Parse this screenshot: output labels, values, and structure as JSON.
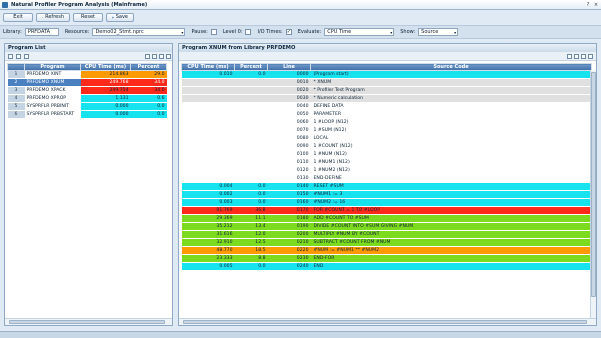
{
  "window": {
    "title": "Natural Profiler Program Analysis (Mainframe)",
    "help": "?",
    "close": "×"
  },
  "toolbar": {
    "exit": "Exit",
    "refresh": "Refresh",
    "reset": "Reset",
    "save": "Save"
  },
  "filters": {
    "library_label": "Library:",
    "library_value": "PRFDATA",
    "resource_label": "Resource:",
    "resource_value": "Demo02_Stmt.nprc",
    "pause_label": "Pause:",
    "pause_checked": false,
    "level0_label": "Level 0:",
    "level0_checked": false,
    "io_label": "I/O Times:",
    "io_checked": true,
    "checkmark": "✓",
    "evaluate_label": "Evaluate:",
    "evaluate_value": "CPU Time",
    "show_label": "Show:",
    "show_value": "Source",
    "dropdown_glyph": "▾"
  },
  "program_list": {
    "title": "Program List",
    "columns": {
      "program": "Program",
      "cpu": "CPU Time (ms)",
      "percent": "Percent"
    },
    "rows": [
      {
        "idx": "1",
        "program": "PRFDEMO XINT",
        "cpu": "214.863",
        "percent": "29.0",
        "cpu_color": "#ff9a00",
        "pct_color": "#ff9a00",
        "selected": false
      },
      {
        "idx": "2",
        "program": "PRFDEMO XNUM",
        "cpu": "249.768",
        "percent": "34.0",
        "cpu_color": "#ff2a1a",
        "pct_color": "#ff2a1a",
        "selected": true
      },
      {
        "idx": "3",
        "program": "PRFDEMO XPACK",
        "cpu": "249.754",
        "percent": "34.0",
        "cpu_color": "#ff2a1a",
        "pct_color": "#ff2a1a",
        "selected": false
      },
      {
        "idx": "4",
        "program": "PRFDEMO XPROP",
        "cpu": "1.131",
        "percent": "0.6",
        "cpu_color": "#17e3ef",
        "pct_color": "#17e3ef",
        "selected": false
      },
      {
        "idx": "5",
        "program": "SYSPRFLR PRBINIT",
        "cpu": "0.000",
        "percent": "0.0",
        "cpu_color": "#17e3ef",
        "pct_color": "#17e3ef",
        "selected": false
      },
      {
        "idx": "6",
        "program": "SYSPRFLR PRBSTART",
        "cpu": "0.000",
        "percent": "0.0",
        "cpu_color": "#17e3ef",
        "pct_color": "#17e3ef",
        "selected": false
      }
    ]
  },
  "source_panel": {
    "title": "Program XNUM from Library PRFDEMO",
    "columns": {
      "cpu": "CPU Time (ms)",
      "percent": "Percent",
      "line": "Line",
      "source": "Source Code"
    },
    "rows": [
      {
        "cpu": "0.010",
        "percent": "0.0",
        "line": "0000",
        "source": "(Program start)",
        "color": "#17e3ef"
      },
      {
        "cpu": "",
        "percent": "",
        "line": "0010",
        "source": "* XNUM",
        "color": "#e0e0e0"
      },
      {
        "cpu": "",
        "percent": "",
        "line": "0020",
        "source": "* Profiler Test Program",
        "color": "#e0e0e0"
      },
      {
        "cpu": "",
        "percent": "",
        "line": "0030",
        "source": "* Numeric calculation",
        "color": "#e0e0e0"
      },
      {
        "cpu": "",
        "percent": "",
        "line": "0040",
        "source": "DEFINE DATA",
        "color": "#ffffff"
      },
      {
        "cpu": "",
        "percent": "",
        "line": "0050",
        "source": "PARAMETER",
        "color": "#ffffff"
      },
      {
        "cpu": "",
        "percent": "",
        "line": "0060",
        "source": "1 #LOOP (N12)",
        "color": "#ffffff"
      },
      {
        "cpu": "",
        "percent": "",
        "line": "0070",
        "source": "1 #SUM (N12)",
        "color": "#ffffff"
      },
      {
        "cpu": "",
        "percent": "",
        "line": "0080",
        "source": "LOCAL",
        "color": "#ffffff"
      },
      {
        "cpu": "",
        "percent": "",
        "line": "0090",
        "source": "1 #COUNT (N12)",
        "color": "#ffffff"
      },
      {
        "cpu": "",
        "percent": "",
        "line": "0100",
        "source": "1 #NUM (N12)",
        "color": "#ffffff"
      },
      {
        "cpu": "",
        "percent": "",
        "line": "0110",
        "source": "1 #NUM1 (N12)",
        "color": "#ffffff"
      },
      {
        "cpu": "",
        "percent": "",
        "line": "0120",
        "source": "1 #NUM2 (N12)",
        "color": "#ffffff"
      },
      {
        "cpu": "",
        "percent": "",
        "line": "0130",
        "source": "END-DEFINE",
        "color": "#ffffff"
      },
      {
        "cpu": "0.004",
        "percent": "0.0",
        "line": "0140",
        "source": "RESET #SUM",
        "color": "#17e3ef"
      },
      {
        "cpu": "0.002",
        "percent": "0.0",
        "line": "0150",
        "source": "#NUM1 := 3",
        "color": "#17e3ef"
      },
      {
        "cpu": "0.003",
        "percent": "0.0",
        "line": "0160",
        "source": "#NUM2 := 16",
        "color": "#17e3ef"
      },
      {
        "cpu": "91.769",
        "percent": "36.8",
        "line": "0170",
        "source": "FOR #COUNT = 1 TO #LOOP",
        "color": "#ff2a1a"
      },
      {
        "cpu": "29.369",
        "percent": "11.1",
        "line": "0180",
        "source": "ADD #COUNT TO #SUM",
        "color": "#7ddb1f"
      },
      {
        "cpu": "35.212",
        "percent": "13.4",
        "line": "0190",
        "source": "DIVIDE #COUNT INTO #SUM GIVING #NUM",
        "color": "#7ddb1f"
      },
      {
        "cpu": "31.616",
        "percent": "12.0",
        "line": "0200",
        "source": "MULTIPLY #NUM BY #COUNT",
        "color": "#7ddb1f"
      },
      {
        "cpu": "32.910",
        "percent": "12.5",
        "line": "0210",
        "source": "SUBTRACT #COUNT FROM #NUM",
        "color": "#7ddb1f"
      },
      {
        "cpu": "48.770",
        "percent": "18.5",
        "line": "0220",
        "source": "#NUM := #NUM1 ** #NUM2",
        "color": "#ff9a00"
      },
      {
        "cpu": "23.333",
        "percent": "8.8",
        "line": "0230",
        "source": "END-FOR",
        "color": "#7ddb1f"
      },
      {
        "cpu": "0.005",
        "percent": "0.0",
        "line": "0240",
        "source": "END",
        "color": "#17e3ef"
      }
    ]
  }
}
